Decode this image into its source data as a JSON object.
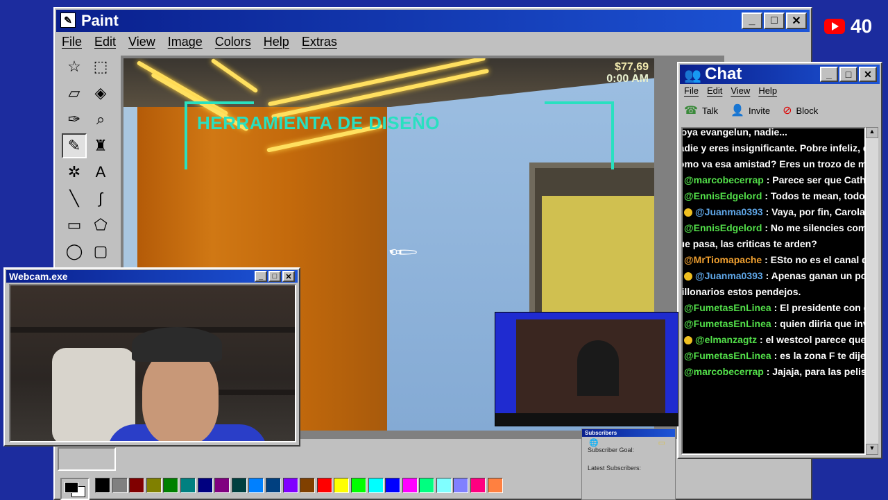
{
  "paint": {
    "title": "Paint",
    "menu": [
      "File",
      "Edit",
      "View",
      "Image",
      "Colors",
      "Help",
      "Extras"
    ],
    "window_buttons": [
      "_",
      "□",
      "✕"
    ],
    "hud": {
      "title": "HERRAMIENTA DE DISEÑO",
      "money": "$77,69",
      "time": "0:00 AM"
    },
    "palette": [
      "#000000",
      "#808080",
      "#800000",
      "#808000",
      "#008000",
      "#008080",
      "#000080",
      "#800080",
      "#004040",
      "#0080ff",
      "#004080",
      "#8000ff",
      "#804000",
      "#ff0000",
      "#ffff00",
      "#00ff00",
      "#00ffff",
      "#0000ff",
      "#ff00ff",
      "#00ff80",
      "#80ffff",
      "#8080ff",
      "#ff0080",
      "#ff8040"
    ]
  },
  "youtube": {
    "count": "40"
  },
  "chat": {
    "title": "Chat",
    "menu": [
      "File",
      "Edit",
      "View",
      "Help"
    ],
    "tools": [
      "Talk",
      "Invite",
      "Block"
    ],
    "messages": [
      {
        "badge": "none",
        "user": "",
        "user_class": "u-green",
        "text": "...oya evangelun, nadie..."
      },
      {
        "badge": "none",
        "user": "",
        "user_class": "",
        "text": "nadie y eres insignificante. Pobre infeliz, que le"
      },
      {
        "badge": "none",
        "user": "",
        "user_class": "",
        "text": "como va esa amistad? Eres un trozo de mierda c"
      },
      {
        "badge": "yt",
        "user": "@marcobecerrap",
        "user_class": "u-green",
        "text": ": Parece ser que Cathyvipy"
      },
      {
        "badge": "yt",
        "user": "@EnnisEdgelord",
        "user_class": "u-green",
        "text": ": Todos te mean, todos te p"
      },
      {
        "badge": "star",
        "user": "@Juanma0393",
        "user_class": "u-blue",
        "text": ": Vaya, por fin, Carola dio u"
      },
      {
        "badge": "yt",
        "user": "@EnnisEdgelord",
        "user_class": "u-green",
        "text": ": No me silencies como me"
      },
      {
        "badge": "none",
        "user": "",
        "user_class": "",
        "text": "que pasa, las criticas te arden?"
      },
      {
        "badge": "yt",
        "user": "@MrTiomapache",
        "user_class": "u-orange",
        "text": ": ESto no es el canal de Da"
      },
      {
        "badge": "star",
        "user": "@Juanma0393",
        "user_class": "u-blue",
        "text": ": Apenas ganan un poco m"
      },
      {
        "badge": "none",
        "user": "",
        "user_class": "",
        "text": "millonarios estos pendejos."
      },
      {
        "badge": "yt",
        "user": "@FumetasEnLinea",
        "user_class": "u-green",
        "text": ": El presidente con gorra"
      },
      {
        "badge": "none",
        "user": "",
        "user_class": "",
        "text": ""
      },
      {
        "badge": "yt",
        "user": "@FumetasEnLinea",
        "user_class": "u-green",
        "text": ": quien diiria que invirtier"
      },
      {
        "badge": "star",
        "user": "@elmanzagtz",
        "user_class": "u-green",
        "text": ": el westcol parece que se p"
      },
      {
        "badge": "yt",
        "user": "@FumetasEnLinea",
        "user_class": "u-green",
        "text": ": es la zona F te dije ayer"
      },
      {
        "badge": "yt",
        "user": "@marcobecerrap",
        "user_class": "u-green",
        "text": ": Jajaja, para las pelis de a"
      }
    ]
  },
  "webcam": {
    "title": "Webcam.exe"
  },
  "subscribers": {
    "title": "Subscribers",
    "goal_label": "Subscriber Goal:",
    "latest_label": "Latest Subscribers:"
  }
}
